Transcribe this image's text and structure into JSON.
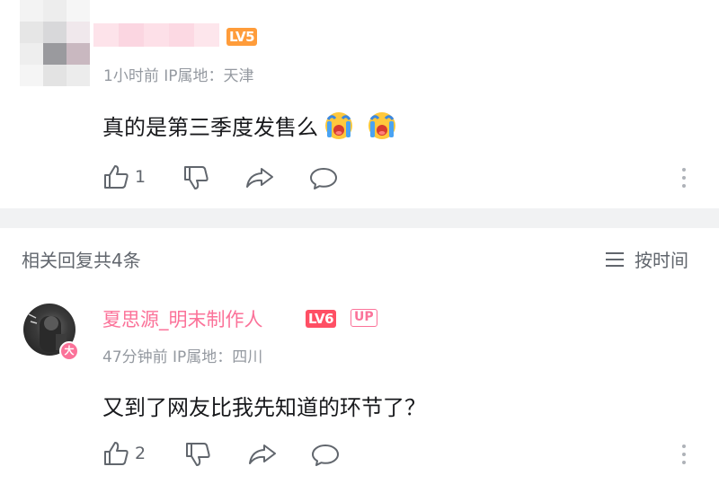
{
  "comment": {
    "level_badge": "LV5",
    "meta": "1小时前  IP属地：天津",
    "text": "真的是第三季度发售么",
    "emojis": [
      "crying-emoji",
      "crying-emoji"
    ],
    "like_count": "1"
  },
  "replies_header": {
    "label": "相关回复共4条",
    "sort_label": "按时间"
  },
  "reply": {
    "username": "夏思源_明末制作人",
    "level_badge": "LV6",
    "up_badge": "UP",
    "avatar_badge": "大",
    "meta": "47分钟前  IP属地：四川",
    "text": "又到了网友比我先知道的环节了？",
    "like_count": "2"
  },
  "colors": {
    "pink": "#fb7299",
    "lv5": "#ff9c3a",
    "lv6": "#ff4f64",
    "divider": "#f1f2f3",
    "meta_text": "#9499a0"
  }
}
